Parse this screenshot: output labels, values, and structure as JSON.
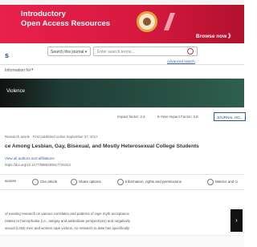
{
  "banner": {
    "line1": "Introductory",
    "line2": "Open Access Resources",
    "browse": "Browse now 》"
  },
  "header": {
    "logo": "s",
    "scope_select": "Search this journal ▾",
    "search_placeholder": "Enter search terms...",
    "advanced_link": "Advanced search"
  },
  "info_bar": {
    "label": "Information for",
    "chevron": "▾"
  },
  "journal": {
    "name": "Violence",
    "impact": "Impact factor: 2.6",
    "impact5": "5-Year Impact Factor: 3.8",
    "journal_button": "JOURNAL HO..."
  },
  "article": {
    "meta": "Research article   ·   First published online September 27, 2017",
    "title": "ce Among Lesbian, Gay, Bisexual, and Mostly Heterosexual College Students",
    "authors": "View all authors and affiliations",
    "doi": "https://doi.org/10.1177/0886260517726414"
  },
  "actions": [
    {
      "label": "access",
      "icon": "lock-icon"
    },
    {
      "label": "Cite article",
      "icon": "quote-icon"
    },
    {
      "label": "Share options",
      "icon": "share-icon"
    },
    {
      "label": "Information, rights and permissions",
      "icon": "info-icon"
    },
    {
      "label": "Metrics and ci",
      "icon": "chart-icon"
    }
  ],
  "abstract": {
    "line1": "of existing research on various correlates and patterns of rape myth acceptance",
    "line2": "relates to homophobia (i.e., antigay and antilesbian perspectives) and negatively",
    "line3": "sexual (LGB) men and women rape victims, no research to date has specifically"
  },
  "side_tab": {
    "label": "›"
  }
}
